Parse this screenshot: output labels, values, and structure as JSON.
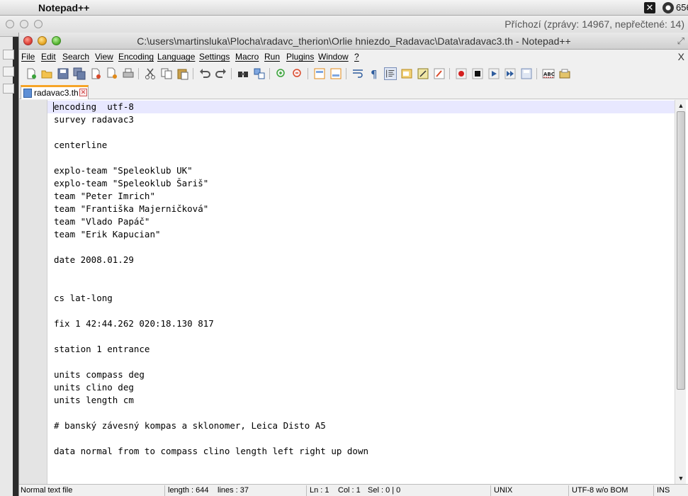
{
  "menubar": {
    "app_name": "Notepad++",
    "clock_fragment": "656"
  },
  "mail": {
    "status": "Příchozí (zprávy: 14967, nepřečtené: 14)"
  },
  "window": {
    "title": "C:\\users\\martinsluka\\Plocha\\radavc_therion\\Orlie hniezdo_Radavac\\Data\\radavac3.th - Notepad++"
  },
  "menu": {
    "items": [
      "File",
      "Edit",
      "Search",
      "View",
      "Encoding",
      "Language",
      "Settings",
      "Macro",
      "Run",
      "Plugins",
      "Window",
      "?"
    ],
    "close_doc": "X"
  },
  "tab": {
    "label": "radavac3.th"
  },
  "editor": {
    "current_line": 1,
    "lines": [
      "encoding  utf-8",
      "survey radavac3",
      "",
      "centerline",
      "",
      "explo-team \"Speleoklub UK\"",
      "explo-team \"Speleoklub Šariš\"",
      "team \"Peter Imrich\"",
      "team \"Františka Majerničková\"",
      "team \"Vlado Papáč\"",
      "team \"Erik Kapucian\"",
      "",
      "date 2008.01.29",
      "",
      "",
      "cs lat-long",
      "",
      "fix 1 42:44.262 020:18.130 817",
      "",
      "station 1 entrance",
      "",
      "units compass deg",
      "units clino deg",
      "units length cm",
      "",
      "# banský závesný kompas a sklonomer, Leica Disto A5",
      "",
      "data normal from to compass clino length left right up down",
      "",
      ""
    ]
  },
  "status": {
    "file_type": "Normal text file",
    "length": "length : 644",
    "lines": "lines : 37",
    "ln": "Ln : 1",
    "col": "Col : 1",
    "sel": "Sel : 0 | 0",
    "eol": "UNIX",
    "encoding": "UTF-8 w/o BOM",
    "mode": "INS"
  }
}
